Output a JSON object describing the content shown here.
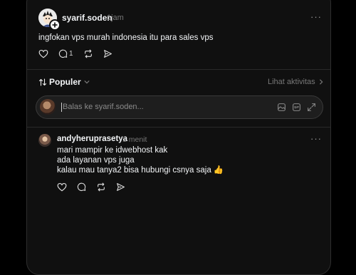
{
  "post": {
    "username": "syarif.soden",
    "time": "1jam",
    "text": "ingfokan vps murah indonesia itu para sales vps",
    "reply_count": "1",
    "more_label": "···"
  },
  "thread": {
    "sort_label": "Populer",
    "activity_label": "Lihat aktivitas"
  },
  "reply_box": {
    "placeholder": "Balas ke syarif.soden..."
  },
  "comment": {
    "username": "andyheruprasetya",
    "time": "1 menit",
    "lines": [
      "mari mampir ke idwebhost kak",
      "ada layanan vps juga",
      "kalau mau tanya2 bisa hubungi csnya saja 👍"
    ],
    "more_label": "···"
  },
  "icons": [
    "heart-icon",
    "comment-icon",
    "repost-icon",
    "share-icon",
    "sort-icon",
    "chevron-down-icon",
    "chevron-right-icon",
    "image-icon",
    "gif-icon",
    "expand-icon",
    "plus-icon"
  ],
  "colors": {
    "background": "#000000",
    "panel": "#101010",
    "text": "#f3f5f7",
    "muted": "#777777"
  }
}
